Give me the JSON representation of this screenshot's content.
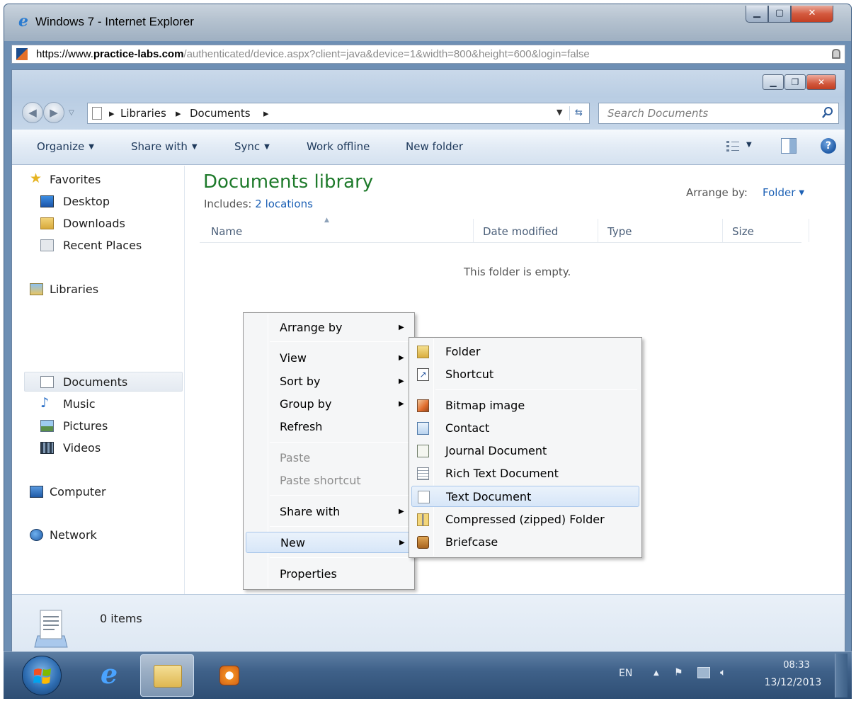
{
  "browser": {
    "title": "Windows 7 - Internet Explorer",
    "url_proto": "https://www.",
    "url_domain": "practice-labs.com",
    "url_rest": "/authenticated/device.aspx?client=java&device=1&width=800&height=600&login=false"
  },
  "explorer": {
    "breadcrumb": [
      "Libraries",
      "Documents"
    ],
    "search_placeholder": "Search Documents",
    "commands": {
      "organize": "Organize",
      "share_with": "Share with",
      "sync": "Sync",
      "work_offline": "Work offline",
      "new_folder": "New folder"
    },
    "nav": {
      "favorites": "Favorites",
      "desktop": "Desktop",
      "downloads": "Downloads",
      "recent_places": "Recent Places",
      "libraries": "Libraries",
      "documents": "Documents",
      "music": "Music",
      "pictures": "Pictures",
      "videos": "Videos",
      "computer": "Computer",
      "network": "Network"
    },
    "library_title": "Documents library",
    "includes_label": "Includes:",
    "includes_link": "2 locations",
    "arrange_label": "Arrange by:",
    "arrange_value": "Folder",
    "columns": [
      "Name",
      "Date modified",
      "Type",
      "Size"
    ],
    "empty_message": "This folder is empty.",
    "item_count": "0 items"
  },
  "context_menu": {
    "arrange_by": "Arrange by",
    "view": "View",
    "sort_by": "Sort by",
    "group_by": "Group by",
    "refresh": "Refresh",
    "paste": "Paste",
    "paste_shortcut": "Paste shortcut",
    "share_with": "Share with",
    "new": "New",
    "properties": "Properties"
  },
  "new_submenu": {
    "folder": "Folder",
    "shortcut": "Shortcut",
    "bitmap": "Bitmap image",
    "contact": "Contact",
    "journal": "Journal Document",
    "rich_text": "Rich Text Document",
    "text": "Text Document",
    "zip": "Compressed (zipped) Folder",
    "briefcase": "Briefcase"
  },
  "taskbar": {
    "language": "EN",
    "time": "08:33",
    "date": "13/12/2013"
  },
  "icons": {
    "start": "windows-start-icon",
    "ie": "internet-explorer-icon",
    "explorer": "explorer-folder-icon",
    "media": "media-player-icon"
  }
}
